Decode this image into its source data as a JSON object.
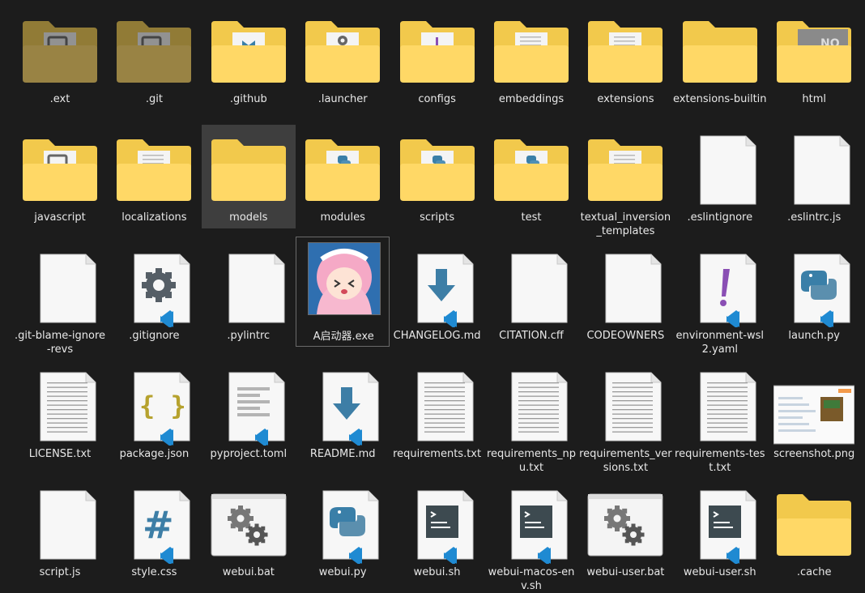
{
  "explorer": {
    "items": [
      {
        "name": ".ext",
        "kind": "folder",
        "overlay": "doc",
        "dim": true
      },
      {
        "name": ".git",
        "kind": "folder",
        "overlay": "doc",
        "dim": true
      },
      {
        "name": ".github",
        "kind": "folder",
        "overlay": "doc-blue"
      },
      {
        "name": ".launcher",
        "kind": "folder",
        "overlay": "gear"
      },
      {
        "name": "configs",
        "kind": "folder",
        "overlay": "purple"
      },
      {
        "name": "embeddings",
        "kind": "folder",
        "overlay": "lines"
      },
      {
        "name": "extensions",
        "kind": "folder",
        "overlay": "lines"
      },
      {
        "name": "extensions-builtin",
        "kind": "folder",
        "overlay": "none"
      },
      {
        "name": "html",
        "kind": "folder",
        "overlay": "no"
      },
      {
        "name": "javascript",
        "kind": "folder",
        "overlay": "doc"
      },
      {
        "name": "localizations",
        "kind": "folder",
        "overlay": "lines"
      },
      {
        "name": "models",
        "kind": "folder",
        "overlay": "none",
        "selected": true
      },
      {
        "name": "modules",
        "kind": "folder",
        "overlay": "python"
      },
      {
        "name": "scripts",
        "kind": "folder",
        "overlay": "python"
      },
      {
        "name": "test",
        "kind": "folder",
        "overlay": "python"
      },
      {
        "name": "textual_inversion_templates",
        "kind": "folder",
        "overlay": "lines"
      },
      {
        "name": ".eslintignore",
        "kind": "blank"
      },
      {
        "name": ".eslintrc.js",
        "kind": "blank"
      },
      {
        "name": ".git-blame-ignore-revs",
        "kind": "blank"
      },
      {
        "name": ".gitignore",
        "kind": "gear-file"
      },
      {
        "name": ".pylintrc",
        "kind": "blank"
      },
      {
        "name": "A启动器.exe",
        "kind": "exe"
      },
      {
        "name": "CHANGELOG.md",
        "kind": "md-file"
      },
      {
        "name": "CITATION.cff",
        "kind": "blank"
      },
      {
        "name": "CODEOWNERS",
        "kind": "blank"
      },
      {
        "name": "environment-wsl2.yaml",
        "kind": "yaml-file"
      },
      {
        "name": "launch.py",
        "kind": "py-file"
      },
      {
        "name": "LICENSE.txt",
        "kind": "txt-file"
      },
      {
        "name": "package.json",
        "kind": "json-file"
      },
      {
        "name": "pyproject.toml",
        "kind": "toml-file"
      },
      {
        "name": "README.md",
        "kind": "md-file"
      },
      {
        "name": "requirements.txt",
        "kind": "txt-file"
      },
      {
        "name": "requirements_npu.txt",
        "kind": "txt-file"
      },
      {
        "name": "requirements_versions.txt",
        "kind": "txt-file"
      },
      {
        "name": "requirements-test.txt",
        "kind": "txt-file"
      },
      {
        "name": "screenshot.png",
        "kind": "png"
      },
      {
        "name": "script.js",
        "kind": "blank"
      },
      {
        "name": "style.css",
        "kind": "css-file"
      },
      {
        "name": "webui.bat",
        "kind": "bat-file"
      },
      {
        "name": "webui.py",
        "kind": "py-file"
      },
      {
        "name": "webui.sh",
        "kind": "sh-file"
      },
      {
        "name": "webui-macos-env.sh",
        "kind": "sh-file"
      },
      {
        "name": "webui-user.bat",
        "kind": "bat-file"
      },
      {
        "name": "webui-user.sh",
        "kind": "sh-file"
      },
      {
        "name": ".cache",
        "kind": "folder",
        "overlay": "none"
      }
    ]
  },
  "colors": {
    "background": "#1c1c1c",
    "folder_back": "#f2c94c",
    "folder_front": "#ffd866",
    "selection": "#3e3e3e",
    "vscode_blue": "#1f8ad2",
    "python_blue": "#3a7fa8",
    "python_yellow": "#5b8fae",
    "gray_icon": "#555e66",
    "purple": "#8a4fb4",
    "json_yellow": "#b6a22e",
    "css_blue": "#3d7ea6"
  }
}
